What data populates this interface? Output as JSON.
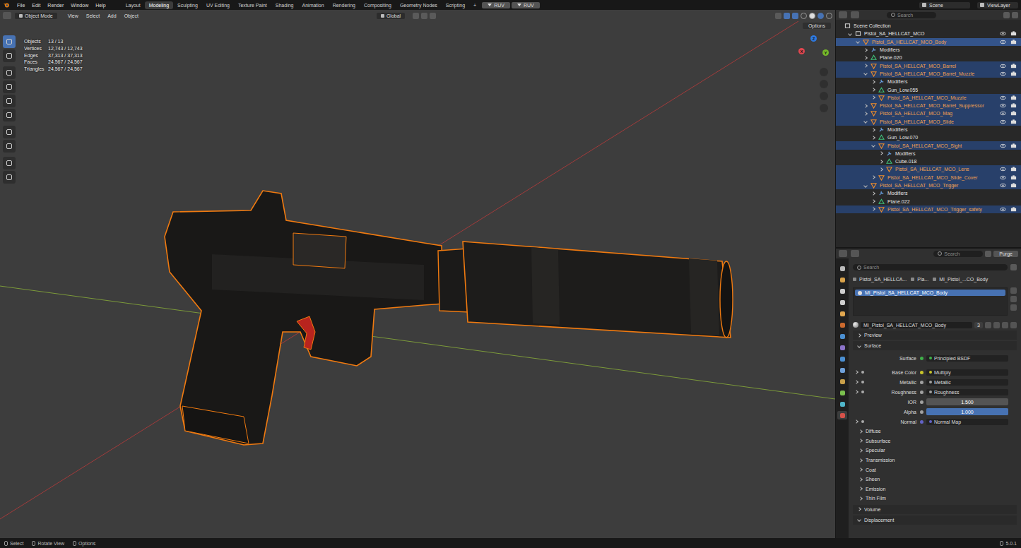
{
  "topbar": {
    "menus": [
      "File",
      "Edit",
      "Render",
      "Window",
      "Help"
    ],
    "workspaces": [
      {
        "label": "Layout",
        "selected": false
      },
      {
        "label": "Modeling",
        "selected": true
      },
      {
        "label": "Sculpting",
        "selected": false
      },
      {
        "label": "UV Editing",
        "selected": false
      },
      {
        "label": "Texture Paint",
        "selected": false
      },
      {
        "label": "Shading",
        "selected": false
      },
      {
        "label": "Animation",
        "selected": false
      },
      {
        "label": "Rendering",
        "selected": false
      },
      {
        "label": "Compositing",
        "selected": false
      },
      {
        "label": "Geometry Nodes",
        "selected": false
      },
      {
        "label": "Scripting",
        "selected": false
      }
    ],
    "add_workspace": "+",
    "addon_buttons": [
      "RUV",
      "RUV"
    ],
    "scene": "Scene",
    "view_layer": "ViewLayer"
  },
  "viewport": {
    "mode": "Object Mode",
    "menus": [
      "View",
      "Select",
      "Add",
      "Object"
    ],
    "orientation": "Global",
    "options": "Options",
    "stats": [
      {
        "label": "Objects",
        "value": "13 / 13"
      },
      {
        "label": "Vertices",
        "value": "12,743 / 12,743"
      },
      {
        "label": "Edges",
        "value": "37,313 / 37,313"
      },
      {
        "label": "Faces",
        "value": "24,567 / 24,567"
      },
      {
        "label": "Triangles",
        "value": "24,567 / 24,567"
      }
    ],
    "gizmo": [
      {
        "label": "Z",
        "color": "#2f7ae0"
      },
      {
        "label": "X",
        "color": "#e0464f"
      },
      {
        "label": "Y",
        "color": "#76b82a"
      }
    ]
  },
  "outliner": {
    "search_placeholder": "Search",
    "rows": [
      {
        "label": "Scene Collection",
        "depth": 0,
        "kind": "scene",
        "selected": false,
        "active": false
      },
      {
        "label": "Pistol_SA_HELLCAT_MCO",
        "depth": 1,
        "kind": "collection",
        "expanded": true,
        "selected": false,
        "active": false
      },
      {
        "label": "Pistol_SA_HELLCAT_MCO_Body",
        "depth": 2,
        "kind": "object",
        "expanded": true,
        "selected": true,
        "active": true
      },
      {
        "label": "Modifiers",
        "depth": 3,
        "kind": "modifiers",
        "expanded": false,
        "selected": false,
        "active": false
      },
      {
        "label": "Plane.020",
        "depth": 3,
        "kind": "mesh",
        "expanded": false,
        "selected": false,
        "active": false
      },
      {
        "label": "Pistol_SA_HELLCAT_MCO_Barrel",
        "depth": 3,
        "kind": "object",
        "expanded": false,
        "selected": true,
        "active": false
      },
      {
        "label": "Pistol_SA_HELLCAT_MCO_Barrel_Muzzle",
        "depth": 3,
        "kind": "object",
        "expanded": true,
        "selected": true,
        "active": false
      },
      {
        "label": "Modifiers",
        "depth": 4,
        "kind": "modifiers",
        "expanded": false,
        "selected": false,
        "active": false
      },
      {
        "label": "Gun_Low.055",
        "depth": 4,
        "kind": "mesh",
        "expanded": false,
        "selected": false,
        "active": false
      },
      {
        "label": "Pistol_SA_HELLCAT_MCO_Muzzle",
        "depth": 4,
        "kind": "object",
        "expanded": false,
        "selected": true,
        "active": false
      },
      {
        "label": "Pistol_SA_HELLCAT_MCO_Barrel_Suppressor",
        "depth": 3,
        "kind": "object",
        "expanded": false,
        "selected": true,
        "active": false
      },
      {
        "label": "Pistol_SA_HELLCAT_MCO_Mag",
        "depth": 3,
        "kind": "object",
        "expanded": false,
        "selected": true,
        "active": false
      },
      {
        "label": "Pistol_SA_HELLCAT_MCO_Slide",
        "depth": 3,
        "kind": "object",
        "expanded": true,
        "selected": true,
        "active": false
      },
      {
        "label": "Modifiers",
        "depth": 4,
        "kind": "modifiers",
        "expanded": false,
        "selected": false,
        "active": false
      },
      {
        "label": "Gun_Low.070",
        "depth": 4,
        "kind": "mesh",
        "expanded": false,
        "selected": false,
        "active": false
      },
      {
        "label": "Pistol_SA_HELLCAT_MCO_Sight",
        "depth": 4,
        "kind": "object",
        "expanded": true,
        "selected": true,
        "active": false
      },
      {
        "label": "Modifiers",
        "depth": 5,
        "kind": "modifiers",
        "expanded": false,
        "selected": false,
        "active": false
      },
      {
        "label": "Cube.018",
        "depth": 5,
        "kind": "mesh",
        "expanded": false,
        "selected": false,
        "active": false
      },
      {
        "label": "Pistol_SA_HELLCAT_MCO_Lens",
        "depth": 5,
        "kind": "object",
        "expanded": false,
        "selected": true,
        "active": false
      },
      {
        "label": "Pistol_SA_HELLCAT_MCO_Slide_Cover",
        "depth": 4,
        "kind": "object",
        "expanded": false,
        "selected": true,
        "active": false
      },
      {
        "label": "Pistol_SA_HELLCAT_MCO_Trigger",
        "depth": 3,
        "kind": "object",
        "expanded": true,
        "selected": true,
        "active": false
      },
      {
        "label": "Modifiers",
        "depth": 4,
        "kind": "modifiers",
        "expanded": false,
        "selected": false,
        "active": false
      },
      {
        "label": "Plane.022",
        "depth": 4,
        "kind": "mesh",
        "expanded": false,
        "selected": false,
        "active": false
      },
      {
        "label": "Pistol_SA_HELLCAT_MCO_Trigger_safety",
        "depth": 4,
        "kind": "object",
        "expanded": false,
        "selected": true,
        "active": false
      }
    ]
  },
  "properties": {
    "header_search_placeholder": "Search",
    "purge": "Purge",
    "search_placeholder": "Search",
    "tabs": [
      {
        "selected": false
      },
      {
        "selected": false
      },
      {
        "selected": false
      },
      {
        "selected": false
      },
      {
        "selected": false
      },
      {
        "selected": false
      },
      {
        "selected": false
      },
      {
        "selected": false
      },
      {
        "selected": false
      },
      {
        "selected": false
      },
      {
        "selected": false
      },
      {
        "selected": false
      },
      {
        "selected": false
      },
      {
        "selected": true
      }
    ],
    "breadcrumb": [
      "Pistol_SA_HELLCA...",
      "Pla...",
      "MI_Pistol_...CO_Body"
    ],
    "material_slots": [
      {
        "label": "MI_Pistol_SA_HELLCAT_MCO_Body",
        "selected": true
      }
    ],
    "material_name": "MI_Pistol_SA_HELLCAT_MCO_Body",
    "users": "3",
    "items": [
      {
        "kind": "panel",
        "label": "Preview",
        "expanded": false
      },
      {
        "kind": "panel",
        "label": "Surface",
        "expanded": true
      },
      {
        "kind": "socket",
        "label": "Surface",
        "value": "Principled BSDF",
        "color": "#3fb04a",
        "expandable": false
      },
      {
        "kind": "socket",
        "label": "Base Color",
        "value": "Multiply",
        "color": "#c8c52a",
        "expandable": true
      },
      {
        "kind": "socket",
        "label": "Metallic",
        "value": "Metallic",
        "color": "#a1a1a1",
        "expandable": true
      },
      {
        "kind": "socket",
        "label": "Roughness",
        "value": "Roughness",
        "color": "#a1a1a1",
        "expandable": true
      },
      {
        "kind": "slider",
        "label": "IOR",
        "value": "1.500",
        "level": 0,
        "color": "#a1a1a1",
        "expandable": false
      },
      {
        "kind": "slider",
        "label": "Alpha",
        "value": "1.000",
        "level": 1,
        "color": "#a1a1a1",
        "expandable": false
      },
      {
        "kind": "socket",
        "label": "Normal",
        "value": "Normal Map",
        "color": "#6363c7",
        "expandable": true
      },
      {
        "kind": "subpanel",
        "label": "Diffuse",
        "expanded": false
      },
      {
        "kind": "subpanel",
        "label": "Subsurface",
        "expanded": false
      },
      {
        "kind": "subpanel",
        "label": "Specular",
        "expanded": false
      },
      {
        "kind": "subpanel",
        "label": "Transmission",
        "expanded": false
      },
      {
        "kind": "subpanel",
        "label": "Coat",
        "expanded": false
      },
      {
        "kind": "subpanel",
        "label": "Sheen",
        "expanded": false
      },
      {
        "kind": "subpanel",
        "label": "Emission",
        "expanded": false
      },
      {
        "kind": "subpanel",
        "label": "Thin Film",
        "expanded": false
      },
      {
        "kind": "panel",
        "label": "Volume",
        "expanded": false
      },
      {
        "kind": "panel",
        "label": "Displacement",
        "expanded": true
      }
    ]
  },
  "status_bar": {
    "hints": [
      "Select",
      "Rotate View",
      "Options"
    ],
    "version": "5.0.1"
  }
}
